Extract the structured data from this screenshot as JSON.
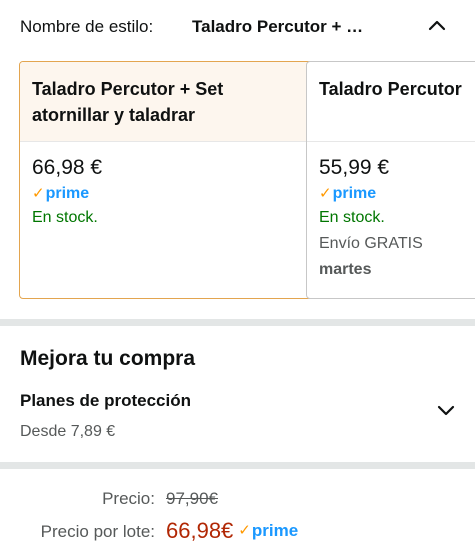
{
  "style_selector": {
    "label": "Nombre de estilo:",
    "value": "Taladro Percutor + …",
    "chevron": "chevron-up-icon"
  },
  "options": [
    {
      "title_line1": "Taladro Percutor + Set",
      "title_line2": "atornillar y taladrar",
      "price": "66,98 €",
      "prime": "prime",
      "stock": "En stock.",
      "selected": true
    },
    {
      "title_line1": "Taladro Percutor",
      "price": "55,99 €",
      "prime": "prime",
      "stock": "En stock.",
      "shipping": "Envío GRATIS",
      "shipping_day": "martes",
      "selected": false
    }
  ],
  "upgrade": {
    "title": "Mejora tu compra",
    "protection_title": "Planes de protección",
    "protection_from": "Desde 7,89 €",
    "chevron": "chevron-down-icon"
  },
  "pricing": {
    "list_label": "Precio:",
    "list_value": "97,90€",
    "lot_label": "Precio por lote:",
    "lot_value": "66,98€",
    "prime": "prime"
  },
  "colors": {
    "selected_border": "#e3a54f",
    "prime_blue": "#1a98ff",
    "prime_check": "#ff9900",
    "in_stock": "#007600",
    "deal_price": "#b12704"
  }
}
